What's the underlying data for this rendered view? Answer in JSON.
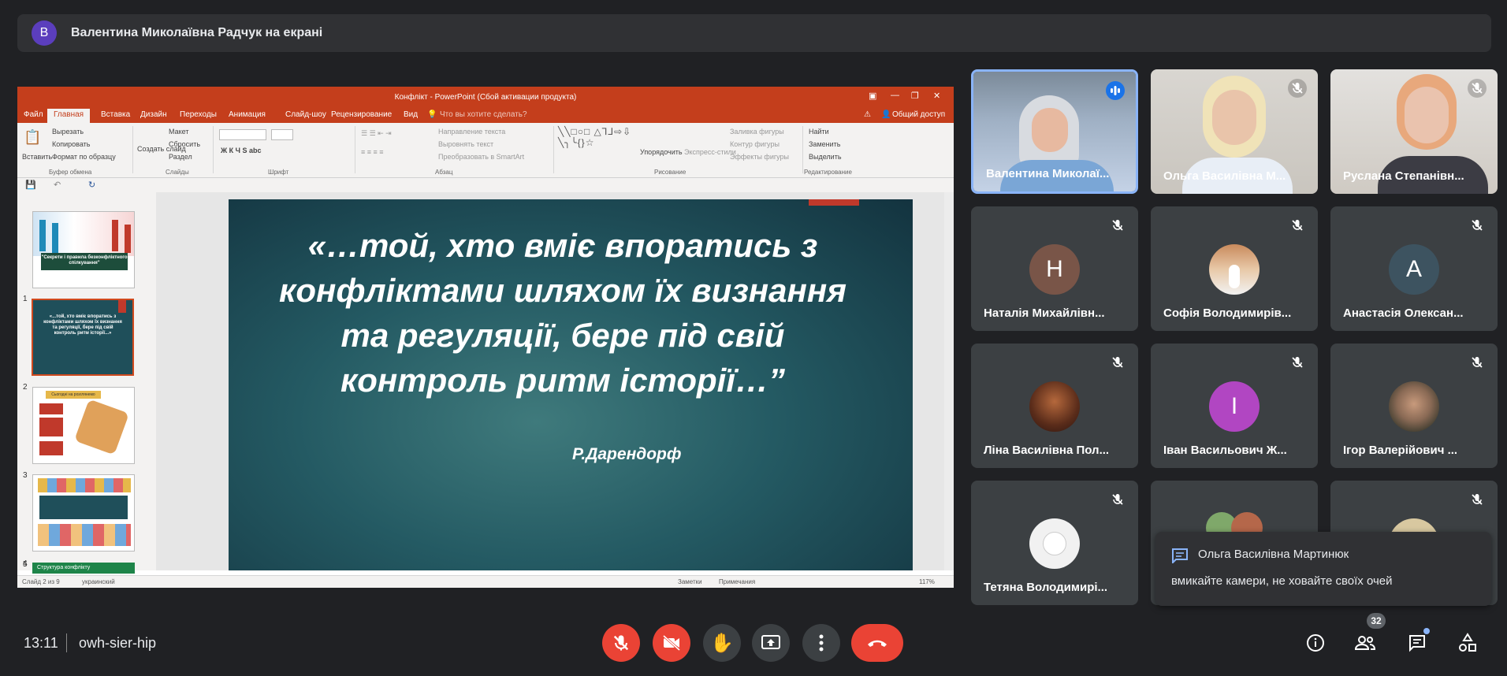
{
  "banner": {
    "avatar_letter": "В",
    "text": "Валентина Миколаївна Радчук на екрані"
  },
  "powerpoint": {
    "window_title": "Конфлікт - PowerPoint (Сбой активации продукта)",
    "tabs": [
      "Файл",
      "Главная",
      "Вставка",
      "Дизайн",
      "Переходы",
      "Анимация",
      "Слайд-шоу",
      "Рецензирование",
      "Вид"
    ],
    "active_tab": "Главная",
    "tell_me": "Что вы хотите сделать?",
    "share": "Общий доступ",
    "ribbon": {
      "clipboard": [
        "Вставить",
        "Вырезать",
        "Копировать",
        "Формат по образцу"
      ],
      "clipboard_group": "Буфер обмена",
      "slides": [
        "Создать слайд",
        "Макет",
        "Сбросить",
        "Раздел"
      ],
      "slides_group": "Слайды",
      "font_group": "Шрифт",
      "paragraph": [
        "Направление текста",
        "Выровнять текст",
        "Преобразовать в SmartArt"
      ],
      "paragraph_group": "Абзац",
      "drawing": [
        "Упорядочить",
        "Экспресс-стили",
        "Заливка фигуры",
        "Контур фигуры",
        "Эффекты фигуры"
      ],
      "drawing_group": "Рисование",
      "editing": [
        "Найти",
        "Заменить",
        "Выделить"
      ],
      "editing_group": "Редактирование"
    },
    "thumbnails": [
      {
        "num": "1",
        "text": "\"Секрети і правила безконфліктного спілкування\""
      },
      {
        "num": "2",
        "text": "«...той, хто вміє впоратись з конфліктами шляхом їх визнання та регуляції, бере під свій контроль ритм історії...»"
      },
      {
        "num": "3",
        "text": "Сьогодні на розглянемо"
      },
      {
        "num": "4",
        "text": ""
      },
      {
        "num": "5",
        "text": "Структура конфлікту"
      }
    ],
    "slide": {
      "quote": "«…той, хто вміє впоратись з конфліктами шляхом їх визнання  та регуляції, бере під свій контроль ритм історії…”",
      "author": "Р.Дарендорф"
    },
    "status": {
      "slide_info": "Слайд 2 из 9",
      "language": "украинский",
      "notes": "Заметки",
      "comments": "Примечания",
      "zoom": "117%"
    }
  },
  "participants": [
    {
      "name": "Валентина Миколаї...",
      "type": "video",
      "speaking": true
    },
    {
      "name": "Ольга Василівна М...",
      "type": "video",
      "muted": true
    },
    {
      "name": "Руслана Степанівн...",
      "type": "video",
      "muted": true
    },
    {
      "name": "Наталія Михайлівн...",
      "type": "letter",
      "letter": "Н",
      "color": "#795548",
      "muted": true
    },
    {
      "name": "Софія Володимирів...",
      "type": "photo",
      "muted": true
    },
    {
      "name": "Анастасія Олексан...",
      "type": "letter",
      "letter": "А",
      "color": "#3d5360",
      "muted": true
    },
    {
      "name": "Ліна Василівна Пол...",
      "type": "photo",
      "muted": true
    },
    {
      "name": "Іван Васильович Ж...",
      "type": "letter",
      "letter": "І",
      "color": "#b146c2",
      "muted": true
    },
    {
      "name": "Ігор Валерійович ...",
      "type": "photo",
      "muted": true
    },
    {
      "name": "Тетяна Володимирі...",
      "type": "photo",
      "muted": true
    }
  ],
  "chat_popup": {
    "from": "Ольга Василівна Мартинюк",
    "message": "вмикайте камери, не ховайте своїх очей"
  },
  "bottom": {
    "time": "13:11",
    "meeting_code": "owh-sier-hip",
    "participant_count": "32"
  },
  "colors": {
    "bg": "#202124",
    "tile": "#3c4043",
    "danger": "#ea4335",
    "speaking": "#1a73e8"
  }
}
